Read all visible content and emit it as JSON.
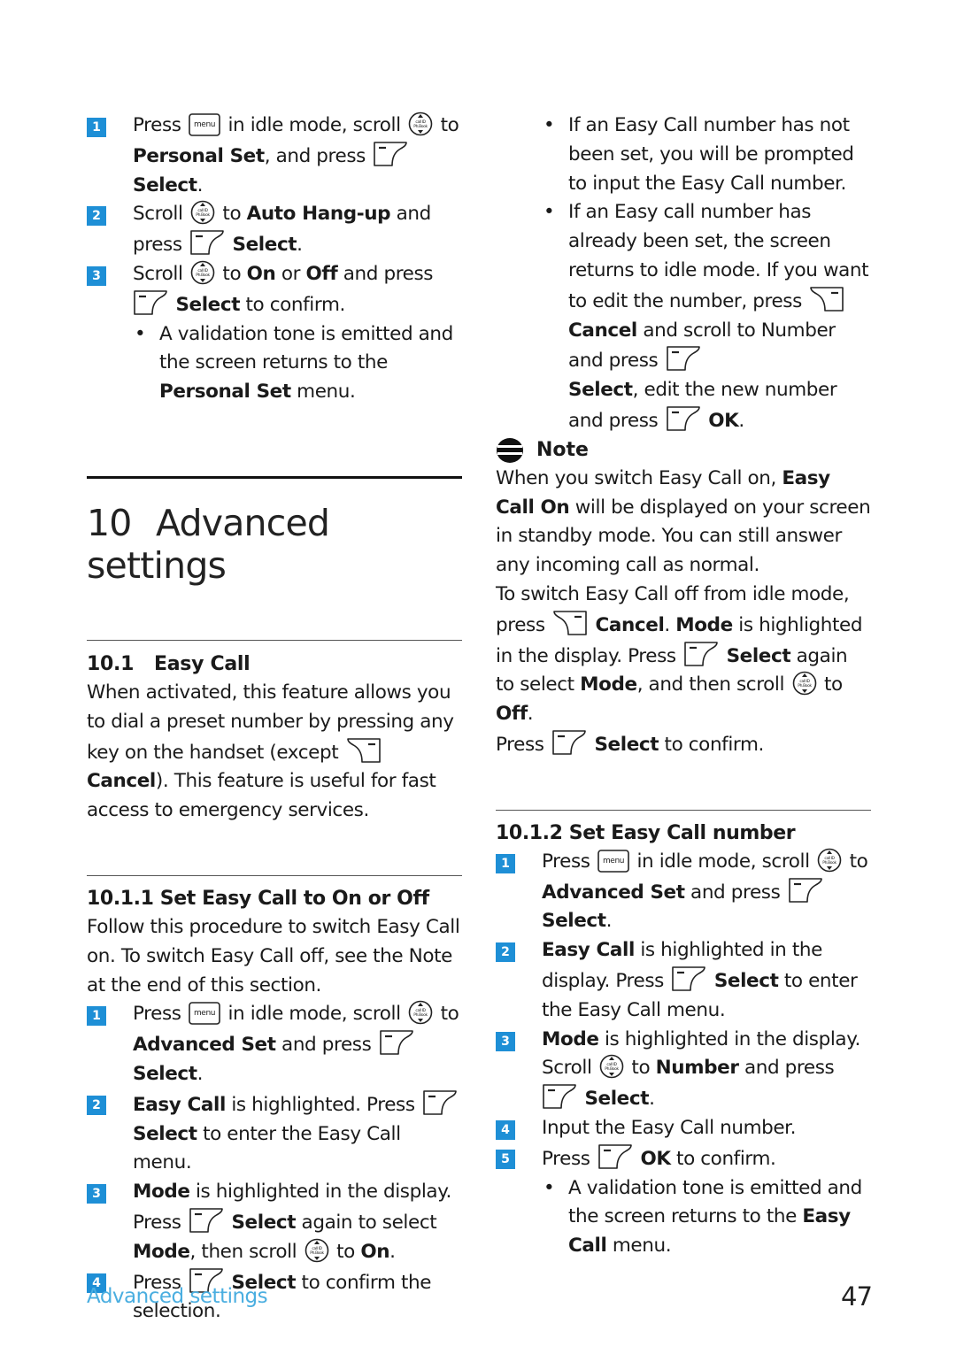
{
  "colors": {
    "accent": "#1e8fd6",
    "footer": "#4aaee0"
  },
  "icons": {
    "menu_key": "menu-key-icon",
    "nav_key": "scroll-navigation-key-icon",
    "left_softkey": "left-softkey-select-icon",
    "right_softkey": "right-softkey-cancel-icon",
    "note": "note-icon",
    "menu_key_label": "menu",
    "nav_key_top": "call ID",
    "nav_key_bottom": "Ph.Book"
  },
  "left": {
    "prev_steps": [
      {
        "n": "1",
        "t1": "Press",
        "t2": "in idle mode, scroll",
        "t3": "to",
        "b1": "Personal Set",
        "t4": ", and press",
        "b2": "Select",
        "t5": "."
      },
      {
        "n": "2",
        "t1": "Scroll",
        "t2": "to",
        "b1": "Auto Hang-up",
        "t3": "and",
        "t4": "press",
        "b2": "Select",
        "t5": "."
      },
      {
        "n": "3",
        "t1": "Scroll",
        "t2": "to",
        "b1": "On",
        "t3": "or",
        "b2": "Off",
        "t4": "and press",
        "b3": "Select",
        "t5": "to confirm."
      }
    ],
    "prev_bullet": {
      "dot": "•",
      "t1": "A validation tone is emitted and the screen returns to the",
      "b1": "Personal Set",
      "t2": "menu."
    },
    "chapter": {
      "number": "10",
      "title": "Advanced settings"
    },
    "section": {
      "number": "10.1",
      "title": "Easy Call"
    },
    "section_text": {
      "t1": "When activated, this feature allows you to dial a preset number by pressing any key on the handset (except",
      "b1": "Cancel",
      "t2": "). This feature is useful for fast access to emergency services."
    },
    "sub1": {
      "title": "10.1.1 Set Easy Call to On or Off",
      "intro": "Follow this procedure to switch Easy Call on. To switch Easy Call off, see the Note at the end of this section.",
      "steps": [
        {
          "n": "1",
          "t1": "Press",
          "t2": "in idle mode, scroll",
          "t3": "to",
          "b1": "Advanced Set",
          "t4": "and press",
          "b2": "Select",
          "t5": "."
        },
        {
          "n": "2",
          "b1": "Easy Call",
          "t1": "is highlighted. Press",
          "b2": "Select",
          "t2": "to enter the Easy Call menu."
        },
        {
          "n": "3",
          "b1": "Mode",
          "t1": "is highlighted in the display.",
          "t2": "Press",
          "b2": "Select",
          "t3": "again to select",
          "b3": "Mode",
          "t4": ", then scroll",
          "t5": "to",
          "b4": "On",
          "t6": "."
        },
        {
          "n": "4",
          "t1": "Press",
          "b1": "Select",
          "t2": "to confirm the selection."
        }
      ]
    }
  },
  "right": {
    "bullets": [
      {
        "dot": "•",
        "text": "If an Easy Call number has not been set, you will be prompted to input the Easy Call number."
      },
      {
        "dot": "•",
        "t1": "If an Easy call number has already been set, the screen returns to idle mode. If you want to edit the number, press",
        "b1": "Cancel",
        "t2": "and scroll to Number and press",
        "b2": "Select",
        "t3": ", edit the new number and press",
        "b3": "OK",
        "t4": "."
      }
    ],
    "note": {
      "label": "Note",
      "p1": {
        "t1": "When you switch Easy Call on,",
        "b1": "Easy Call On",
        "t2": "will be displayed on your screen in standby mode. You can still answer any incoming call as normal."
      },
      "p2": {
        "t1": "To switch Easy Call off from idle mode, press",
        "b1": "Cancel",
        "t2": ".",
        "b2": "Mode",
        "t3": "is highlighted in the display. Press",
        "b3": "Select",
        "t4": "again to select",
        "b4": "Mode",
        "t5": ", and then scroll",
        "t6": "to",
        "b5": "Off",
        "t7": ".",
        "t8": "Press",
        "b6": "Select",
        "t9": "to confirm."
      }
    },
    "sub2": {
      "title": "10.1.2 Set Easy Call number",
      "steps": [
        {
          "n": "1",
          "t1": "Press",
          "t2": "in idle mode, scroll",
          "t3": "to",
          "b1": "Advanced Set",
          "t4": "and press",
          "b2": "Select",
          "t5": "."
        },
        {
          "n": "2",
          "b1": "Easy Call",
          "t1": "is highlighted in the display. Press",
          "b2": "Select",
          "t2": "to enter the Easy Call menu."
        },
        {
          "n": "3",
          "b1": "Mode",
          "t1": "is highlighted in the display. Scroll",
          "t2": "to",
          "b2": "Number",
          "t3": "and press",
          "b3": "Select",
          "t4": "."
        },
        {
          "n": "4",
          "t1": "Input the Easy Call number."
        },
        {
          "n": "5",
          "t1": "Press",
          "b1": "OK",
          "t2": "to confirm."
        }
      ],
      "bullet": {
        "dot": "•",
        "t1": "A validation tone is emitted and the screen returns to the",
        "b1": "Easy Call",
        "t2": "menu."
      }
    }
  },
  "footer": {
    "section": "Advanced settings",
    "page": "47"
  }
}
